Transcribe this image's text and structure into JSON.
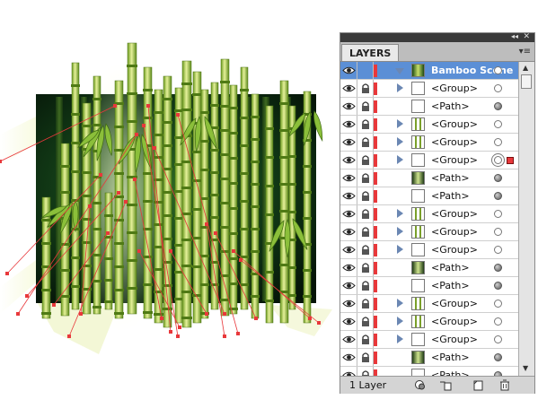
{
  "panel": {
    "title": "LAYERS",
    "collapse_glyph": "◂◂",
    "close_glyph": "✕",
    "menu_glyph": "▾≡",
    "status": "1 Layer",
    "accent_color": "#5b8fd6",
    "layer_color": "#e8383b",
    "buttons": [
      {
        "name": "make-clipping-mask-button",
        "icon": "circle-mask-icon"
      },
      {
        "name": "new-sublayer-button",
        "icon": "new-sublayer-icon"
      },
      {
        "name": "new-layer-button",
        "icon": "new-layer-icon"
      },
      {
        "name": "delete-layer-button",
        "icon": "trash-icon"
      }
    ]
  },
  "rows": [
    {
      "label": "Bamboo Scene",
      "kind": "layer",
      "expanded": true,
      "target": "open",
      "selected": true
    },
    {
      "label": "<Group>",
      "kind": "group",
      "target": "open"
    },
    {
      "label": "<Path>",
      "kind": "path",
      "target": "filled"
    },
    {
      "label": "<Group>",
      "kind": "group",
      "target": "open"
    },
    {
      "label": "<Group>",
      "kind": "group",
      "target": "open"
    },
    {
      "label": "<Group>",
      "kind": "group",
      "target": "double",
      "selected": true
    },
    {
      "label": "<Path>",
      "kind": "path",
      "target": "filled"
    },
    {
      "label": "<Path>",
      "kind": "path",
      "target": "filled"
    },
    {
      "label": "<Group>",
      "kind": "group",
      "target": "open"
    },
    {
      "label": "<Group>",
      "kind": "group",
      "target": "open"
    },
    {
      "label": "<Group>",
      "kind": "group",
      "target": "open"
    },
    {
      "label": "<Path>",
      "kind": "path",
      "target": "filled"
    },
    {
      "label": "<Path>",
      "kind": "path",
      "target": "filled"
    },
    {
      "label": "<Group>",
      "kind": "group",
      "target": "open"
    },
    {
      "label": "<Group>",
      "kind": "group",
      "target": "open"
    },
    {
      "label": "<Group>",
      "kind": "group",
      "target": "open"
    },
    {
      "label": "<Path>",
      "kind": "path",
      "target": "filled"
    },
    {
      "label": "<Path>",
      "kind": "path",
      "target": "filled"
    }
  ],
  "artwork": {
    "name": "bamboo-illustration",
    "background": "#0f2a12",
    "stalk_light": "#d9ea6a",
    "stalk_dark": "#5f8a1e",
    "handle_color": "#e8383b"
  }
}
